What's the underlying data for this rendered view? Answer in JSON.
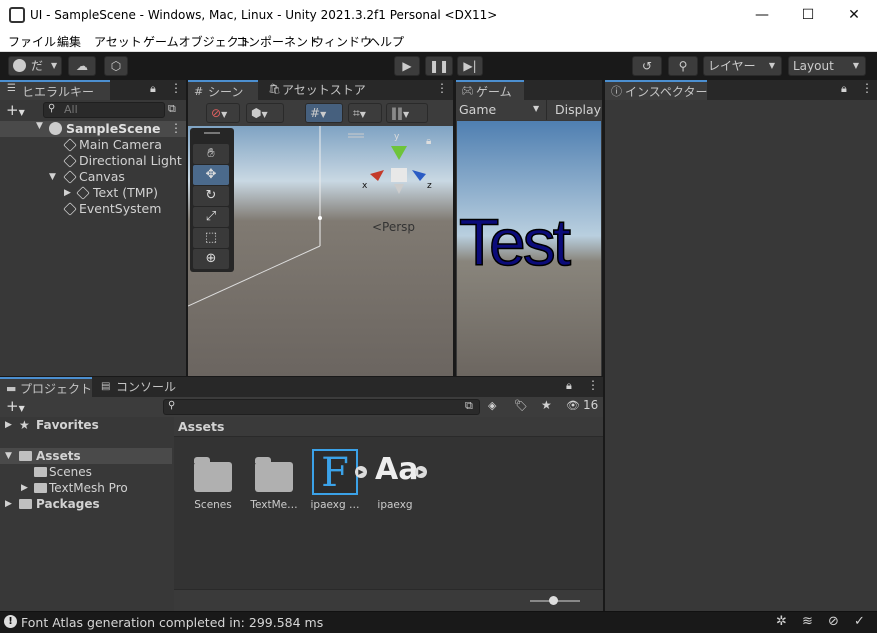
{
  "window": {
    "title": "UI - SampleScene - Windows, Mac, Linux - Unity 2021.3.2f1 Personal <DX11>",
    "minimize": "—",
    "maximize": "☐",
    "close": "✕"
  },
  "menu": [
    "ファイル",
    "編集",
    "アセット",
    "ゲームオブジェクト",
    "コンポーネント",
    "ウィンドウ",
    "ヘルプ"
  ],
  "toolbar": {
    "account": "だ",
    "layers": "レイヤー",
    "layout": "Layout"
  },
  "hierarchy": {
    "tab": "ヒエラルキー",
    "search_placeholder": "All",
    "scene": "SampleScene",
    "items": [
      "Main Camera",
      "Directional Light",
      "Canvas",
      "Text (TMP)",
      "EventSystem"
    ]
  },
  "scene": {
    "tab": "シーン",
    "store_tab": "アセットストア",
    "persp": "<Persp",
    "gizmo_x": "x",
    "gizmo_y": "y",
    "gizmo_z": "z"
  },
  "game": {
    "tab": "ゲーム",
    "display_select": "Game",
    "display": "Display",
    "text": "Test"
  },
  "inspector": {
    "tab": "インスペクター"
  },
  "project": {
    "tab": "プロジェクト",
    "console_tab": "コンソール",
    "favorites": "Favorites",
    "assets": "Assets",
    "scenes": "Scenes",
    "textmesh": "TextMesh Pro",
    "packages": "Packages",
    "breadcrumb": "Assets",
    "count": "16",
    "items": [
      {
        "label": "Scenes"
      },
      {
        "label": "TextMe…"
      },
      {
        "label": "ipaexg …"
      },
      {
        "label": "ipaexg"
      }
    ]
  },
  "status": {
    "message": "Font Atlas generation completed in: 299.584 ms"
  },
  "colors": {
    "accent": "#4c8fd0",
    "panel": "#383838",
    "dark": "#191919",
    "game_text": "#0b0b7a"
  }
}
